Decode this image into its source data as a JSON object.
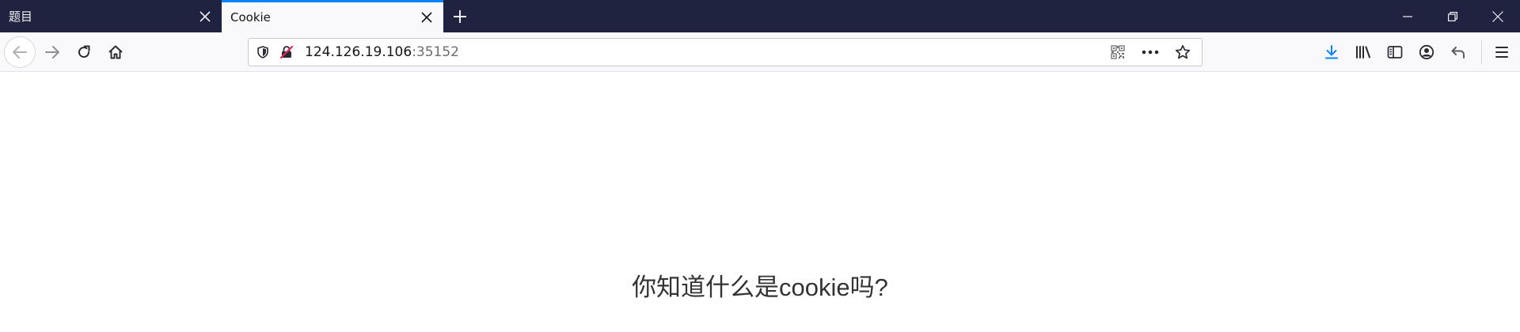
{
  "window": {
    "tabs": [
      {
        "title": "题目",
        "active": false
      },
      {
        "title": "Cookie",
        "active": true
      }
    ],
    "new_tab_icon": "plus-icon",
    "controls": [
      "minimize-icon",
      "restore-icon",
      "close-icon"
    ]
  },
  "navbar": {
    "url_host": "124.126.19.106",
    "url_port": ":35152",
    "icons": {
      "back": "arrow-left-icon",
      "forward": "arrow-right-icon",
      "reload": "reload-icon",
      "home": "home-icon",
      "tracking": "shield-icon",
      "insecure": "insecure-lock-icon",
      "qr": "qr-code-icon",
      "more": "more-icon",
      "bookmark": "star-icon",
      "downloads": "download-icon",
      "library": "library-icon",
      "sidebar": "sidebar-icon",
      "account": "account-icon",
      "undo": "undo-icon",
      "menu": "hamburger-menu-icon"
    }
  },
  "page": {
    "question": "你知道什么是cookie吗?"
  },
  "colors": {
    "tabstrip_bg": "#202340",
    "toolbar_bg": "#f9f9fb",
    "accent": "#0a84ff",
    "text": "#333333"
  }
}
